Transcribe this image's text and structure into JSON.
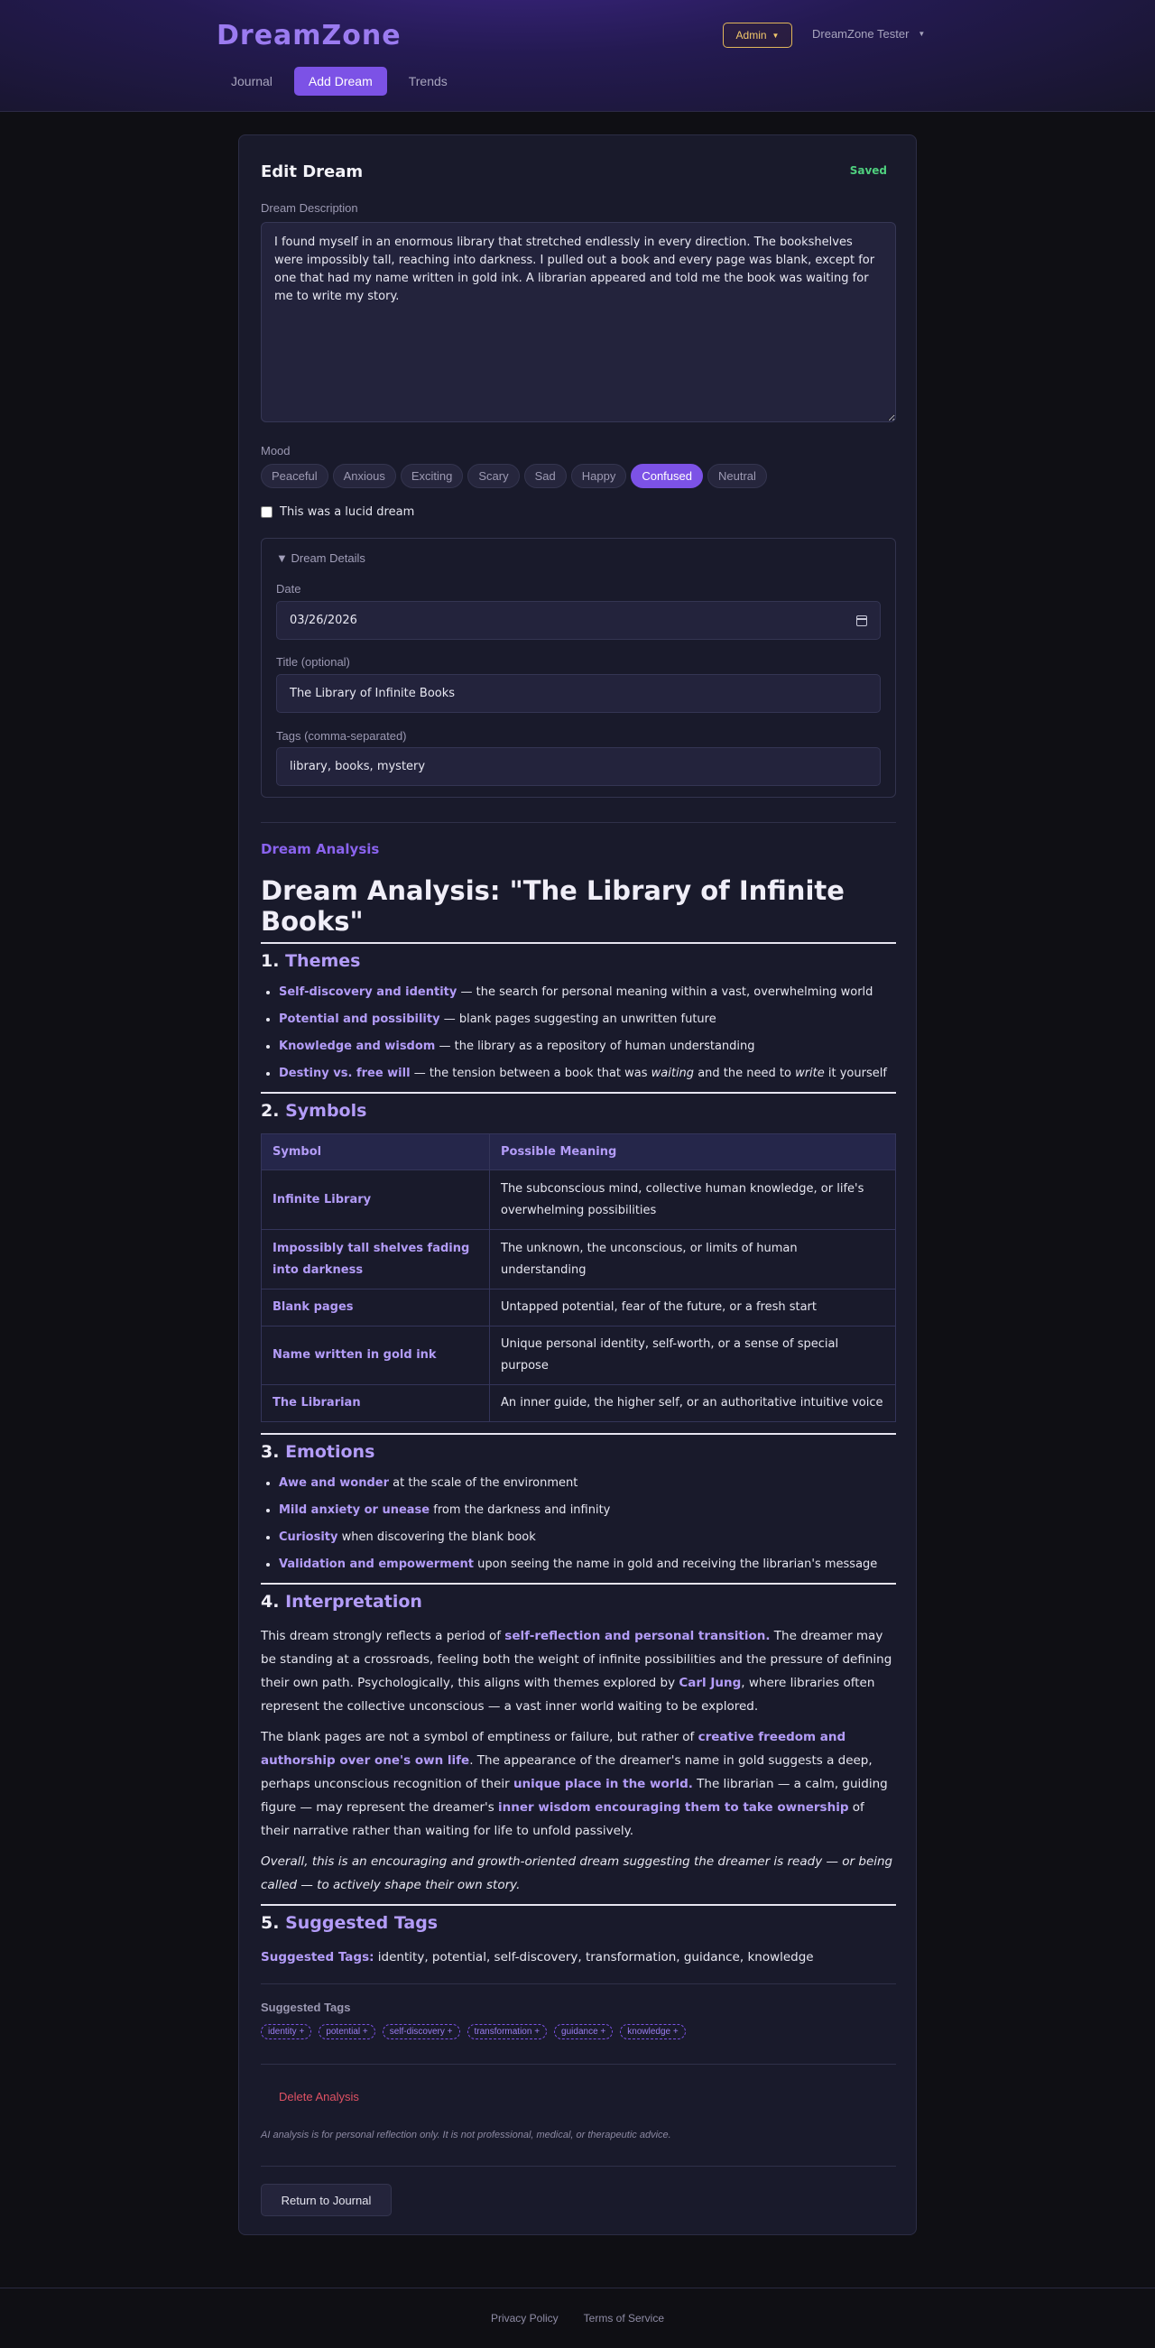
{
  "app": {
    "logo": "DreamZone",
    "nav": [
      "Journal",
      "Add Dream",
      "Trends"
    ],
    "active_nav": "Add Dream",
    "admin_label": "Admin",
    "user_name": "DreamZone Tester"
  },
  "editor": {
    "title": "Edit Dream",
    "status": "Saved",
    "description_label": "Dream Description",
    "description": "I found myself in an enormous library that stretched endlessly in every direction. The bookshelves were impossibly tall, reaching into darkness. I pulled out a book and every page was blank, except for one that had my name written in gold ink. A librarian appeared and told me the book was waiting for me to write my story.",
    "mood_label": "Mood",
    "moods": [
      "Peaceful",
      "Anxious",
      "Exciting",
      "Scary",
      "Sad",
      "Happy",
      "Confused",
      "Neutral"
    ],
    "selected_mood": "Confused",
    "lucid_label": "This was a lucid dream",
    "lucid_checked": false,
    "details": {
      "summary": "Dream Details",
      "date_label": "Date",
      "date_value": "03/26/2026",
      "title_label": "Title (optional)",
      "title_value": "The Library of Infinite Books",
      "tags_label": "Tags (comma-separated)",
      "tags_value": "library, books, mystery"
    }
  },
  "analysis": {
    "section_label": "Dream Analysis",
    "heading": "Dream Analysis: \"The Library of Infinite Books\"",
    "themes": {
      "num": "1.",
      "title": "Themes",
      "items": [
        {
          "strong": "Self-discovery and identity",
          "text": " — the search for personal meaning within a vast, overwhelming world"
        },
        {
          "strong": "Potential and possibility",
          "text": " — blank pages suggesting an unwritten future"
        },
        {
          "strong": "Knowledge and wisdom",
          "text": " — the library as a repository of human understanding"
        },
        {
          "strong": "Destiny vs. free will",
          "text_a": " — the tension between a book that was ",
          "em_a": "waiting",
          "text_b": " and the need to ",
          "em_b": "write",
          "text_c": " it yourself"
        }
      ]
    },
    "symbols": {
      "num": "2.",
      "title": "Symbols",
      "headers": [
        "Symbol",
        "Possible Meaning"
      ],
      "rows": [
        [
          "Infinite Library",
          "The subconscious mind, collective human knowledge, or life's overwhelming possibilities"
        ],
        [
          "Impossibly tall shelves fading into darkness",
          "The unknown, the unconscious, or limits of human understanding"
        ],
        [
          "Blank pages",
          "Untapped potential, fear of the future, or a fresh start"
        ],
        [
          "Name written in gold ink",
          "Unique personal identity, self-worth, or a sense of special purpose"
        ],
        [
          "The Librarian",
          "An inner guide, the higher self, or an authoritative intuitive voice"
        ]
      ]
    },
    "emotions": {
      "num": "3.",
      "title": "Emotions",
      "items": [
        {
          "strong": "Awe and wonder",
          "text": " at the scale of the environment"
        },
        {
          "strong": "Mild anxiety or unease",
          "text": " from the darkness and infinity"
        },
        {
          "strong": "Curiosity",
          "text": " when discovering the blank book"
        },
        {
          "strong": "Validation and empowerment",
          "text": " upon seeing the name in gold and receiving the librarian's message"
        }
      ]
    },
    "interpretation": {
      "num": "4.",
      "title": "Interpretation",
      "p1_a": "This dream strongly reflects a period of ",
      "p1_s1": "self-reflection and personal transition.",
      "p1_b": " The dreamer may be standing at a crossroads, feeling both the weight of infinite possibilities and the pressure of defining their own path. Psychologically, this aligns with themes explored by ",
      "p1_s2": "Carl Jung",
      "p1_c": ", where libraries often represent the collective unconscious — a vast inner world waiting to be explored.",
      "p2_a": "The blank pages are not a symbol of emptiness or failure, but rather of ",
      "p2_s1": "creative freedom and authorship over one's own life",
      "p2_b": ". The appearance of the dreamer's name in gold suggests a deep, perhaps unconscious recognition of their ",
      "p2_s2": "unique place in the world.",
      "p2_c": " The librarian — a calm, guiding figure — may represent the dreamer's ",
      "p2_s3": "inner wisdom encouraging them to take ownership",
      "p2_d": " of their narrative rather than waiting for life to unfold passively.",
      "p3": "Overall, this is an encouraging and growth-oriented dream suggesting the dreamer is ready — or being called — to actively shape their own story."
    },
    "suggested": {
      "num": "5.",
      "title": "Suggested Tags",
      "label": "Suggested Tags:",
      "text": " identity, potential, self-discovery, transformation, guidance, knowledge"
    }
  },
  "tags_panel": {
    "label": "Suggested Tags",
    "chips": [
      "identity +",
      "potential +",
      "self-discovery +",
      "transformation +",
      "guidance +",
      "knowledge +"
    ]
  },
  "actions": {
    "delete": "Delete Analysis",
    "disclaimer": "AI analysis is for personal reflection only. It is not professional, medical, or therapeutic advice.",
    "return": "Return to Journal"
  },
  "footer": {
    "links": [
      "Privacy Policy",
      "Terms of Service"
    ]
  },
  "colors": {
    "accent": "#7c52e6",
    "saved": "#4fd07e",
    "admin": "#f2c86b",
    "danger": "#e05264"
  }
}
